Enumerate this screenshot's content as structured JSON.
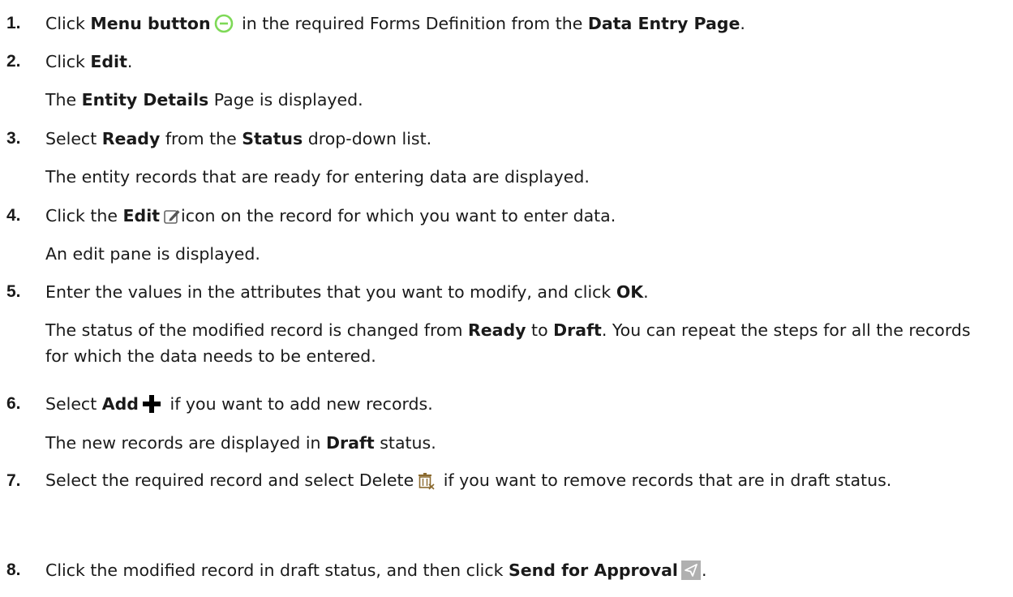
{
  "steps": [
    {
      "number": "1.",
      "t1": "Click ",
      "b1": "Menu button",
      "t2": " in the required Forms Definition from the ",
      "b2": "Data Entry Page",
      "t3": ".",
      "icon": "menu-button-icon"
    },
    {
      "number": "2.",
      "t1": "Click ",
      "b1": "Edit",
      "t2": ".",
      "r_b1": "Entity Details",
      "r_t1": " Page is displayed."
    },
    {
      "number": "3.",
      "t1": "Select ",
      "b1": "Ready",
      "t2": " from the ",
      "b2": "Status",
      "t3": " drop-down list.",
      "result": "The entity records that are ready for entering data are displayed.",
      "r_t0": "The "
    },
    {
      "number": "4.",
      "t1": "Click the ",
      "b1": "Edit",
      "t2": "icon on the record for which you want to enter data.",
      "result": "An edit pane is displayed.",
      "icon": "edit-icon"
    },
    {
      "number": "5.",
      "t1": "Enter the values in the attributes that you want to modify, and click ",
      "b1": "OK",
      "t2": ".",
      "r_t1": "The status of the modified record is changed from ",
      "r_b1": "Ready",
      "r_t2": " to ",
      "r_b2": "Draft",
      "r_t3": ". You can repeat the steps for all the records for which the data needs to be entered."
    },
    {
      "number": "6.",
      "t1": "Select ",
      "b1": "Add",
      "t2": " if you want to add new records.",
      "r_t1": "The new records are displayed in ",
      "r_b1": "Draft",
      "r_t2": " status.",
      "icon": "plus-icon"
    },
    {
      "number": "7.",
      "t1": "Select the required record and select Delete",
      "t2": " if you want to remove records that are in draft status.",
      "icon": "delete-icon"
    },
    {
      "number": "8.",
      "t1": "Click the modified record in draft status, and then click ",
      "b1": "Send for Approval",
      "t2": ".",
      "icon": "send-icon"
    }
  ],
  "colors": {
    "text": "#1a1a1a",
    "menu_icon": "#7ed957",
    "plus_icon": "#000000",
    "delete_icon": "#8b6a2f",
    "send_icon_bg": "#b0b0b0"
  }
}
